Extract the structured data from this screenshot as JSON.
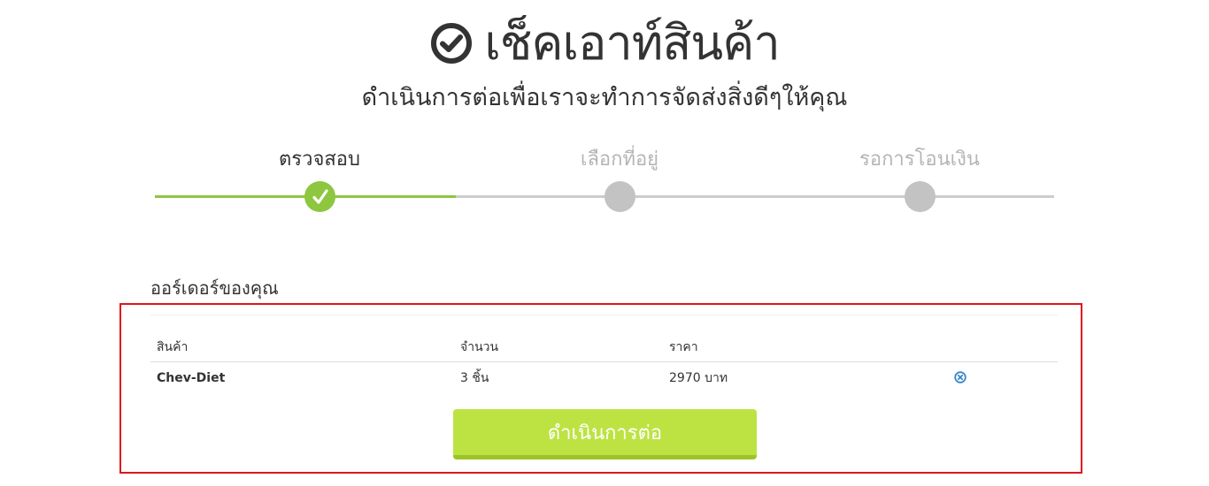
{
  "header": {
    "title": "เช็คเอาท์สินค้า",
    "subtitle": "ดำเนินการต่อเพื่อเราจะทำการจัดส่งสิ่งดีๆให้คุณ",
    "title_icon": "check-circle-icon"
  },
  "steps": [
    {
      "label": "ตรวจสอบ",
      "status": "done"
    },
    {
      "label": "เลือกที่อยู่",
      "status": "pending"
    },
    {
      "label": "รอการโอนเงิน",
      "status": "pending"
    }
  ],
  "orders": {
    "title": "ออร์เดอร์ของคุณ",
    "columns": {
      "product": "สินค้า",
      "quantity": "จำนวน",
      "price": "ราคา"
    },
    "rows": [
      {
        "product": "Chev-Diet",
        "quantity": "3 ชิ้น",
        "price": "2970 บาท",
        "remove_icon": "remove-circle-icon"
      }
    ],
    "continue_label": "ดำเนินการต่อ"
  },
  "colors": {
    "accent_green": "#8dc63f",
    "button_green": "#bde343",
    "inactive_gray": "#c3c3c3",
    "highlight_border": "#e0141b",
    "remove_icon_blue": "#3a87c8"
  }
}
